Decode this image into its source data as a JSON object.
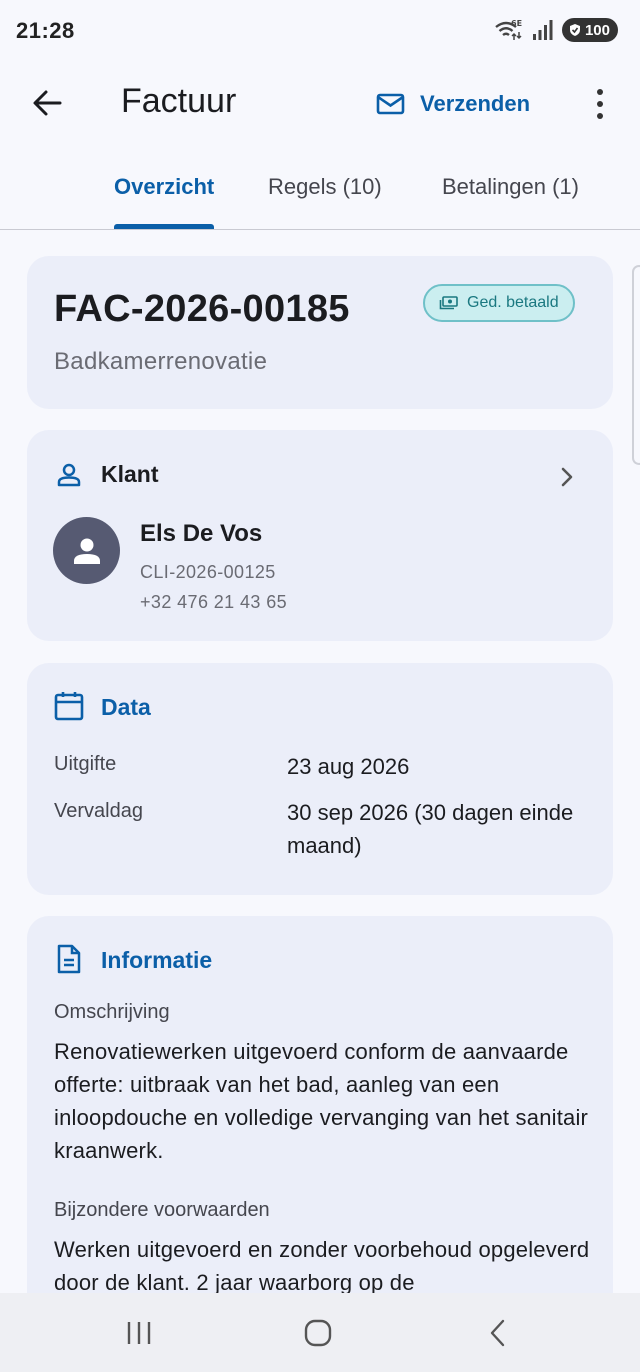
{
  "status_bar": {
    "time": "21:28",
    "battery": "100",
    "icons": [
      "wifi-6e-icon",
      "signal-icon",
      "battery-icon"
    ]
  },
  "app_bar": {
    "title": "Factuur",
    "send_label": "Verzenden",
    "accent_color": "#0b5fa8"
  },
  "tabs": [
    {
      "label": "Overzicht",
      "active": true
    },
    {
      "label": "Regels (10)",
      "active": false
    },
    {
      "label": "Betalingen (1)",
      "active": false
    }
  ],
  "invoice": {
    "number": "FAC-2026-00185",
    "subtitle": "Badkamerrenovatie",
    "status": "Ged. betaald"
  },
  "client": {
    "header": "Klant",
    "name": "Els De Vos",
    "id": "CLI-2026-00125",
    "phone": "+32 476 21 43 65"
  },
  "dates": {
    "header": "Data",
    "rows": [
      {
        "label": "Uitgifte",
        "value": "23 aug 2026"
      },
      {
        "label": "Vervaldag",
        "value": "30 sep 2026 (30 dagen einde maand)"
      }
    ]
  },
  "info": {
    "header": "Informatie",
    "description_label": "Omschrijving",
    "description": "Renovatiewerken uitgevoerd conform de aanvaarde offerte: uitbraak van het bad, aanleg van een inloopdouche en volledige vervanging van het sanitair kraanwerk.",
    "conditions_label": "Bijzondere voorwaarden",
    "conditions": "Werken uitgevoerd en zonder voorbehoud opgeleverd door de klant. 2 jaar waarborg op de"
  }
}
